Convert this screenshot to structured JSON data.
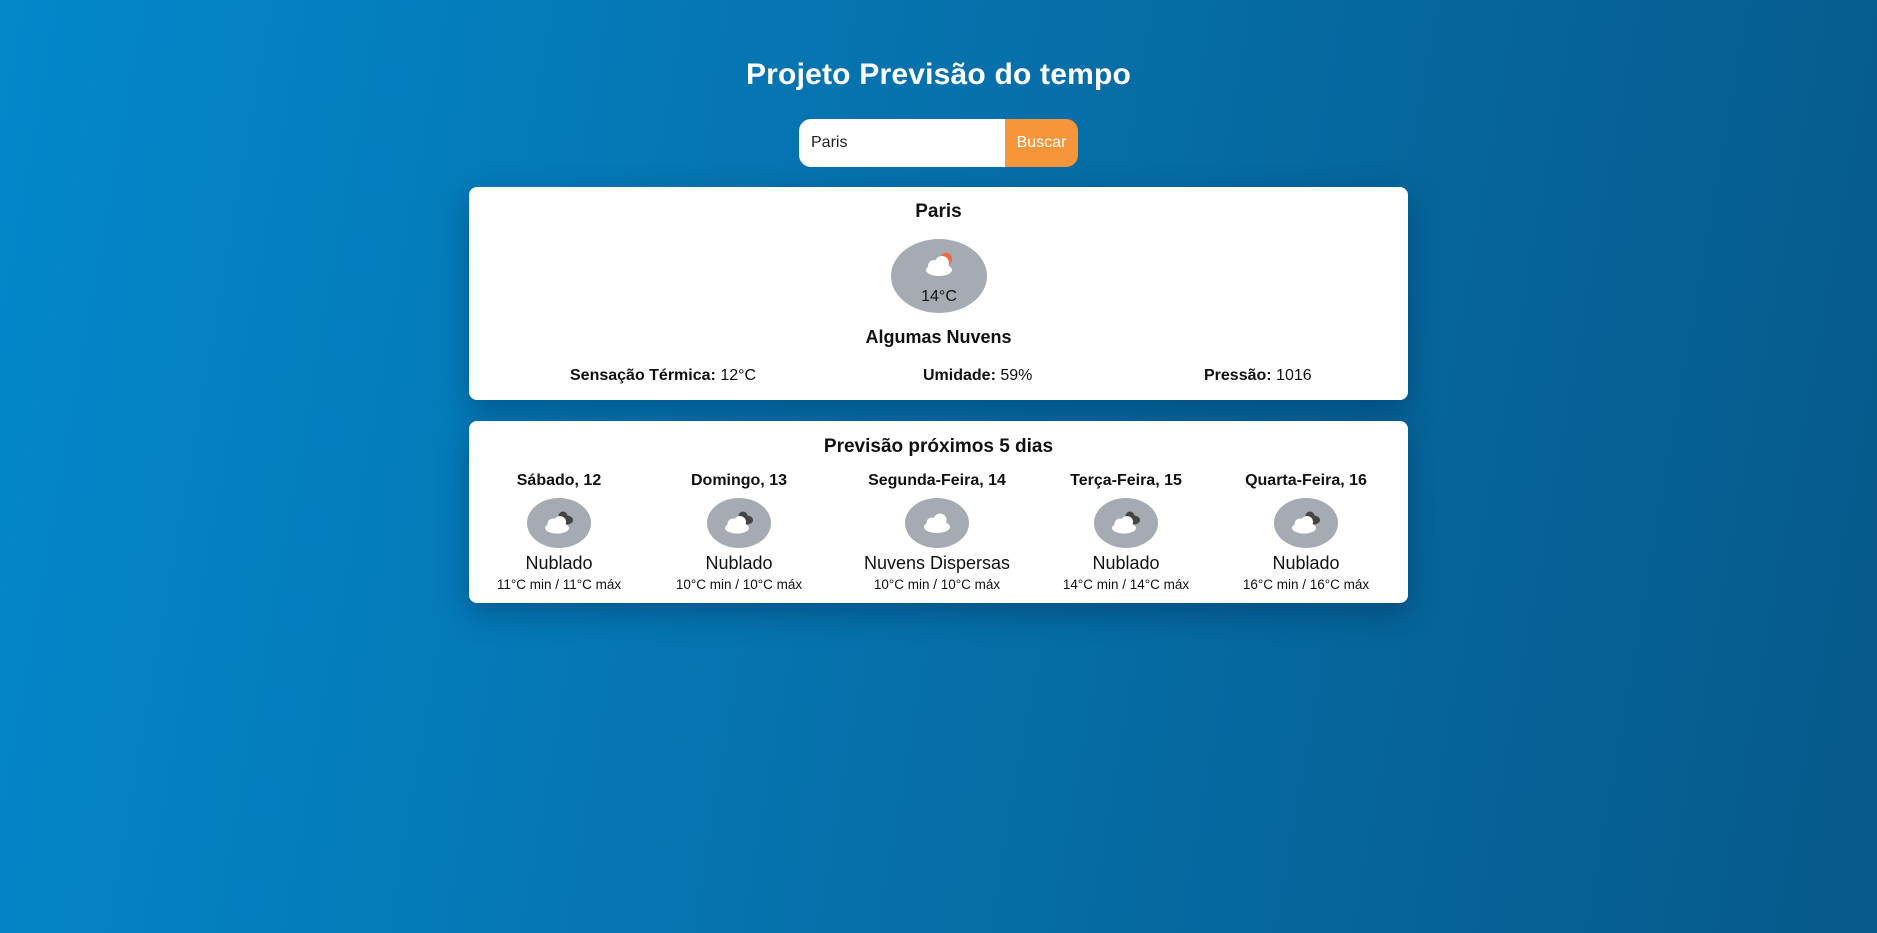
{
  "header": {
    "title": "Projeto Previsão do tempo"
  },
  "search": {
    "value": "Paris",
    "button_label": "Buscar"
  },
  "current": {
    "city": "Paris",
    "icon": "partly-cloudy-day-icon",
    "temperature": "14°C",
    "description": "Algumas Nuvens",
    "details": [
      {
        "label": "Sensação Térmica:",
        "value": "12°C"
      },
      {
        "label": "Umidade:",
        "value": "59%"
      },
      {
        "label": "Pressão:",
        "value": "1016"
      }
    ]
  },
  "forecast": {
    "title": "Previsão próximos 5 dias",
    "days": [
      {
        "name": "Sábado, 12",
        "icon": "overcast-clouds-icon",
        "description": "Nublado",
        "range": "11°C min / 11°C máx"
      },
      {
        "name": "Domingo, 13",
        "icon": "overcast-clouds-icon",
        "description": "Nublado",
        "range": "10°C min / 10°C máx"
      },
      {
        "name": "Segunda-Feira, 14",
        "icon": "scattered-clouds-icon",
        "description": "Nuvens Dispersas",
        "range": "10°C min / 10°C máx"
      },
      {
        "name": "Terça-Feira, 15",
        "icon": "overcast-clouds-icon",
        "description": "Nublado",
        "range": "14°C min / 14°C máx"
      },
      {
        "name": "Quarta-Feira, 16",
        "icon": "overcast-clouds-icon",
        "description": "Nublado",
        "range": "16°C min / 16°C máx"
      }
    ]
  },
  "colors": {
    "accent_button": "#f7953a",
    "icon_badge": "#a6abb3",
    "background_start": "#0388cb",
    "background_end": "#06598a"
  }
}
